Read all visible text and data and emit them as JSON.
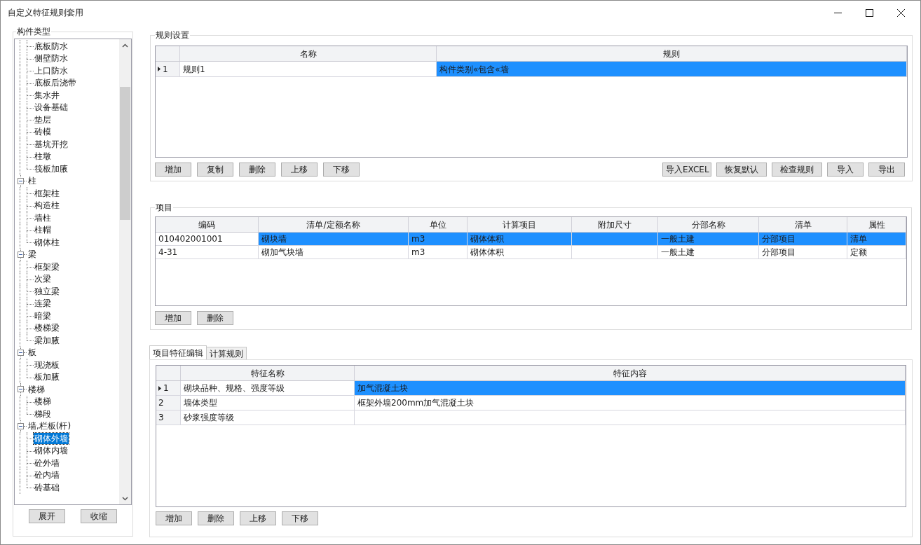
{
  "window": {
    "title": "自定义特征规则套用"
  },
  "component_types": {
    "title": "构件类型",
    "tree": [
      {
        "children": [
          {
            "label": "底板防水",
            "selected": false
          },
          {
            "label": "侧壁防水",
            "selected": false
          },
          {
            "label": "上口防水",
            "selected": false
          },
          {
            "label": "底板后浇带",
            "selected": false
          },
          {
            "label": "集水井",
            "selected": false
          },
          {
            "label": "设备基础",
            "selected": false
          },
          {
            "label": "垫层",
            "selected": false
          },
          {
            "label": "砖模",
            "selected": false
          },
          {
            "label": "基坑开挖",
            "selected": false
          },
          {
            "label": "柱墩",
            "selected": false
          },
          {
            "label": "筏板加腋",
            "selected": false
          }
        ]
      },
      {
        "label": "柱",
        "expanded": true,
        "selected": false,
        "children": [
          {
            "label": "框架柱",
            "selected": false
          },
          {
            "label": "构造柱",
            "selected": false
          },
          {
            "label": "墙柱",
            "selected": false
          },
          {
            "label": "柱帽",
            "selected": false
          },
          {
            "label": "砌体柱",
            "selected": false
          }
        ]
      },
      {
        "label": "梁",
        "expanded": true,
        "selected": false,
        "children": [
          {
            "label": "框架梁",
            "selected": false
          },
          {
            "label": "次梁",
            "selected": false
          },
          {
            "label": "独立梁",
            "selected": false
          },
          {
            "label": "连梁",
            "selected": false
          },
          {
            "label": "暗梁",
            "selected": false
          },
          {
            "label": "楼梯梁",
            "selected": false
          },
          {
            "label": "梁加腋",
            "selected": false
          }
        ]
      },
      {
        "label": "板",
        "expanded": true,
        "selected": false,
        "children": [
          {
            "label": "现浇板",
            "selected": false
          },
          {
            "label": "板加腋",
            "selected": false
          }
        ]
      },
      {
        "label": "楼梯",
        "expanded": true,
        "selected": false,
        "children": [
          {
            "label": "楼梯",
            "selected": false
          },
          {
            "label": "梯段",
            "selected": false
          }
        ]
      },
      {
        "label": "墙,栏板(杆)",
        "expanded": true,
        "selected": false,
        "children": [
          {
            "label": "砌体外墙",
            "selected": true
          },
          {
            "label": "砌体内墙",
            "selected": false
          },
          {
            "label": "砼外墙",
            "selected": false
          },
          {
            "label": "砼内墙",
            "selected": false
          },
          {
            "label": "砖基础",
            "selected": false
          }
        ]
      }
    ],
    "buttons": [
      "展开",
      "收缩"
    ]
  },
  "rule_settings": {
    "title": "规则设置",
    "columns": [
      "",
      "名称",
      "规则"
    ],
    "rows": [
      {
        "cells": [
          "1",
          "规则1",
          "构件类别«包含«墙"
        ],
        "selected": true
      }
    ],
    "left_buttons": [
      "增加",
      "复制",
      "删除",
      "上移",
      "下移"
    ],
    "right_buttons": [
      "导入EXCEL",
      "恢复默认",
      "检查规则",
      "导入",
      "导出"
    ]
  },
  "items": {
    "title": "项目",
    "columns": [
      "编码",
      "清单/定额名称",
      "单位",
      "计算项目",
      "附加尺寸",
      "分部名称",
      "清单",
      "属性"
    ],
    "rows": [
      {
        "cells": [
          "010402001001",
          "砌块墙",
          "m3",
          "砌体体积",
          "",
          "一般土建",
          "分部项目",
          "清单"
        ],
        "selected": true
      },
      {
        "cells": [
          "4-31",
          "砌加气块墙",
          "m3",
          "砌体体积",
          "",
          "一般土建",
          "分部项目",
          "定额"
        ],
        "selected": false
      }
    ],
    "buttons": [
      "增加",
      "删除"
    ]
  },
  "features": {
    "tabs": [
      {
        "label": "项目特征编辑",
        "selected": true
      },
      {
        "label": "计算规则",
        "selected": false
      }
    ],
    "columns": [
      "",
      "特征名称",
      "特征内容"
    ],
    "rows": [
      {
        "cells": [
          "1",
          "砌块品种、规格、强度等级",
          "加气混凝土块"
        ],
        "selected": true
      },
      {
        "cells": [
          "2",
          "墙体类型",
          "框架外墙200mm加气混凝土块"
        ],
        "selected": false
      },
      {
        "cells": [
          "3",
          "砂浆强度等级",
          ""
        ],
        "selected": false
      }
    ],
    "buttons": [
      "增加",
      "删除",
      "上移",
      "下移"
    ]
  }
}
